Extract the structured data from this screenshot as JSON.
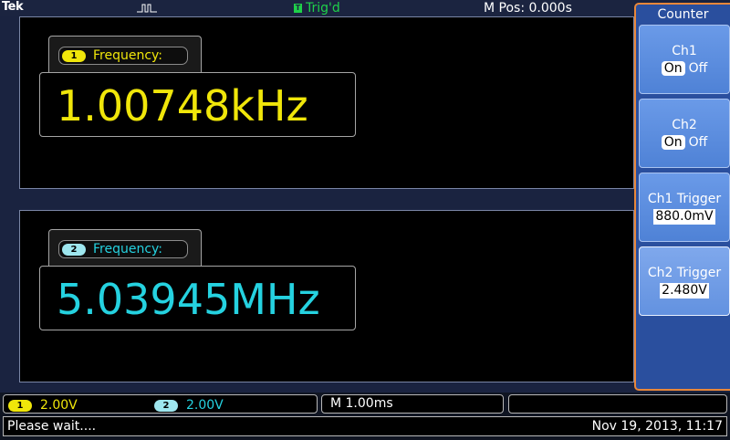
{
  "header": {
    "brand": "Tek",
    "trig_badge": "T",
    "trig_status": "Trig'd",
    "m_pos": "M Pos: 0.000s"
  },
  "measurements": [
    {
      "channel_badge": "1",
      "label": "Frequency:",
      "value": "1.00748kHz",
      "color": "#f0e60a"
    },
    {
      "channel_badge": "2",
      "label": "Frequency:",
      "value": "5.03945MHz",
      "color": "#25d2e0"
    }
  ],
  "channel_settings": {
    "ch1_badge": "1",
    "ch1_scale": "2.00V",
    "ch2_badge": "2",
    "ch2_scale": "2.00V",
    "timebase": "M 1.00ms"
  },
  "status": {
    "message": "Please wait....",
    "datetime": "Nov 19, 2013, 11:17"
  },
  "side_menu": {
    "title": "Counter",
    "buttons": [
      {
        "label": "Ch1",
        "on": "On",
        "off": "Off"
      },
      {
        "label": "Ch2",
        "on": "On",
        "off": "Off"
      },
      {
        "label": "Ch1 Trigger",
        "value": "880.0mV"
      },
      {
        "label": "Ch2 Trigger",
        "value": "2.480V"
      }
    ]
  },
  "icons": {
    "trigger_pulse": "pulse-icon"
  }
}
